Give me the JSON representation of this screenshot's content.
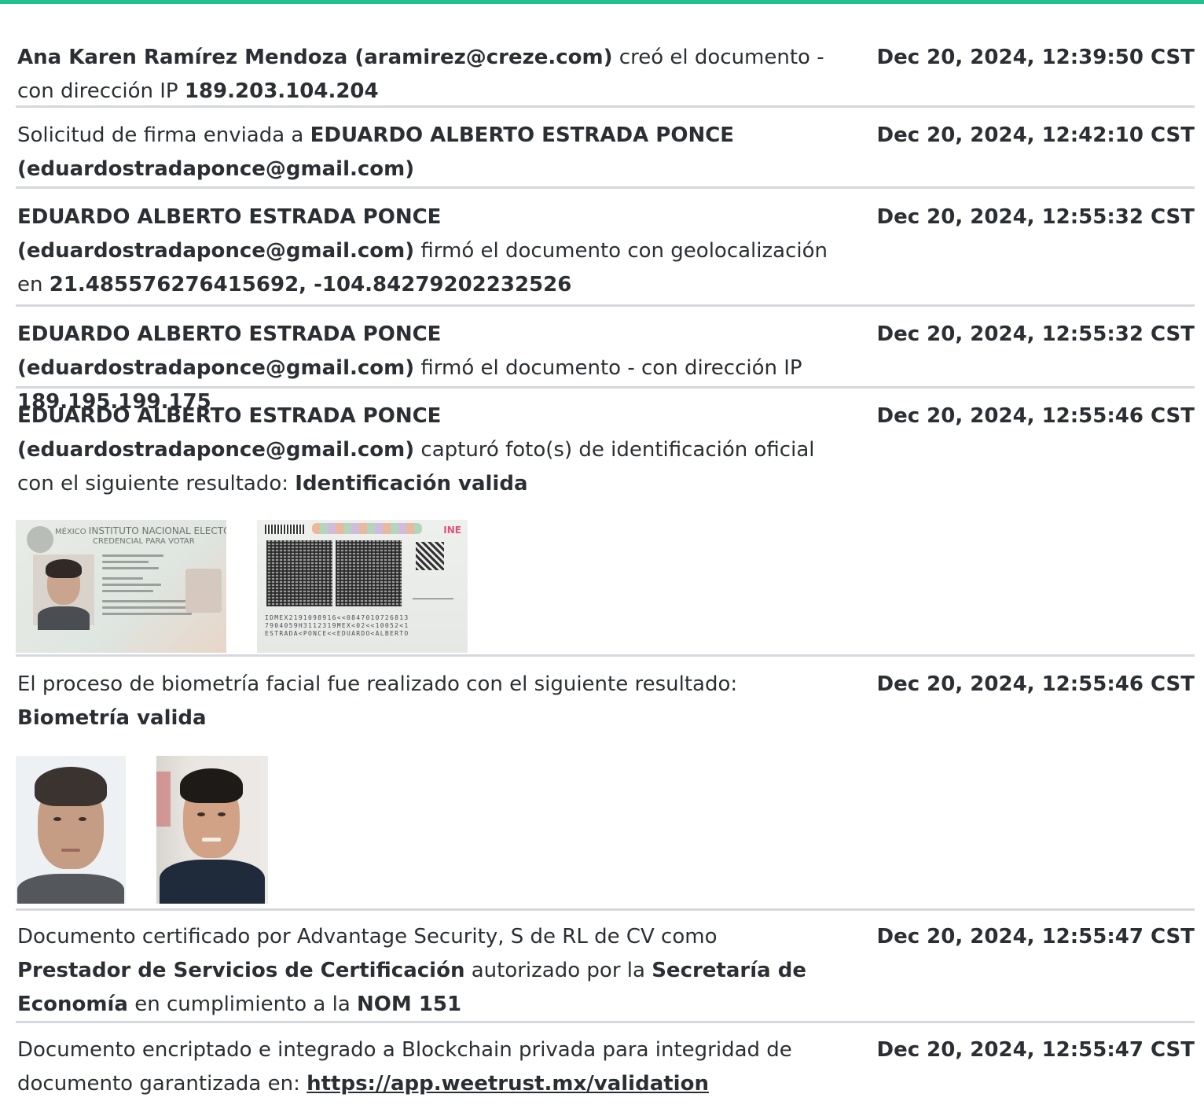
{
  "accent_color": "#1fc28e",
  "entries": [
    {
      "parts": [
        {
          "text": "Ana Karen Ramírez Mendoza (aramirez@creze.com)",
          "bold": true
        },
        {
          "text": " creó el documento - con dirección IP ",
          "bold": false
        },
        {
          "text": "189.203.104.204",
          "bold": true
        }
      ],
      "timestamp": "Dec 20, 2024, 12:39:50 CST"
    },
    {
      "parts": [
        {
          "text": "Solicitud de firma enviada a ",
          "bold": false
        },
        {
          "text": "EDUARDO ALBERTO ESTRADA PONCE",
          "bold": true
        },
        {
          "text": " ",
          "bold": false
        },
        {
          "text": "(eduardostradaponce@gmail.com)",
          "bold": true
        }
      ],
      "timestamp": "Dec 20, 2024, 12:42:10 CST"
    },
    {
      "parts": [
        {
          "text": "EDUARDO ALBERTO ESTRADA PONCE (eduardostradaponce@gmail.com)",
          "bold": true
        },
        {
          "text": " firmó el documento con geolocalización en ",
          "bold": false
        },
        {
          "text": "21.485576276415692, -104.84279202232526",
          "bold": true
        }
      ],
      "timestamp": "Dec 20, 2024, 12:55:32 CST"
    },
    {
      "parts": [
        {
          "text": "EDUARDO ALBERTO ESTRADA PONCE (eduardostradaponce@gmail.com)",
          "bold": true
        },
        {
          "text": " firmó el documento - con dirección IP ",
          "bold": false
        },
        {
          "text": "189.195.199.175",
          "bold": true
        }
      ],
      "timestamp": "Dec 20, 2024, 12:55:32 CST"
    },
    {
      "parts": [
        {
          "text": "EDUARDO ALBERTO ESTRADA PONCE (eduardostradaponce@gmail.com)",
          "bold": true
        },
        {
          "text": " capturó foto(s) de identificación oficial con el siguiente resultado: ",
          "bold": false
        },
        {
          "text": "Identificación valida",
          "bold": true
        }
      ],
      "timestamp": "Dec 20, 2024, 12:55:46 CST"
    },
    {
      "parts": [
        {
          "text": "El proceso de biometría facial fue realizado con el siguiente resultado: ",
          "bold": false
        },
        {
          "text": "Biometría valida",
          "bold": true
        }
      ],
      "timestamp": "Dec 20, 2024, 12:55:46 CST"
    },
    {
      "parts": [
        {
          "text": "Documento certificado por Advantage Security, S de RL de CV como ",
          "bold": false
        },
        {
          "text": "Prestador de Servicios de Certificación",
          "bold": true
        },
        {
          "text": " autorizado por la ",
          "bold": false
        },
        {
          "text": "Secretaría de Economía",
          "bold": true
        },
        {
          "text": " en cumplimiento a la ",
          "bold": false
        },
        {
          "text": "NOM 151",
          "bold": true
        }
      ],
      "timestamp": "Dec 20, 2024, 12:55:47 CST"
    },
    {
      "parts": [
        {
          "text": "Documento encriptado e integrado a Blockchain privada para integridad de documento garantizada en: ",
          "bold": false
        },
        {
          "text": "https://app.weetrust.mx/validation",
          "bold": true,
          "link": true
        }
      ],
      "timestamp": "Dec 20, 2024, 12:55:47 CST"
    }
  ],
  "id_card_front": {
    "country": "MÉXICO",
    "institute": "INSTITUTO NACIONAL ELECTORAL",
    "card_type": "CREDENCIAL PARA VOTAR"
  },
  "id_card_back": {
    "brand": "INE",
    "mrz_lines": [
      "IDMEX2191098916<<0847010726813",
      "7904059H3112319MEX<02<<10052<1",
      "ESTRADA<PONCE<<EDUARDO<ALBERTO"
    ]
  }
}
